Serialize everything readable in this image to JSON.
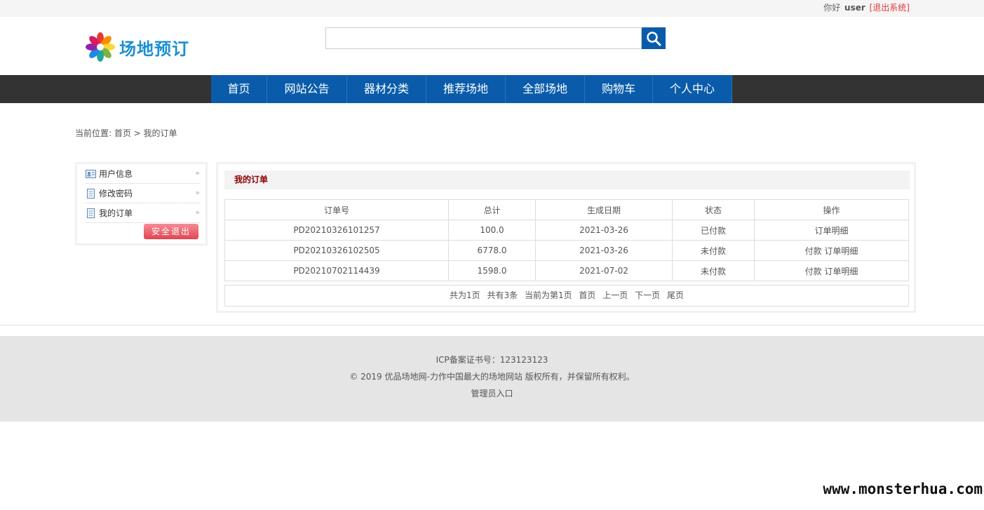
{
  "topbar": {
    "greeting": "你好",
    "username": "user",
    "logout_link": "[退出系统]"
  },
  "header": {
    "site_title": "场地预订",
    "search_placeholder": "",
    "search_icon": "search-icon"
  },
  "nav": {
    "items": [
      "首页",
      "网站公告",
      "器材分类",
      "推荐场地",
      "全部场地",
      "购物车",
      "个人中心"
    ]
  },
  "breadcrumb": {
    "text": "当前位置: 首页 > 我的订单"
  },
  "sidebar": {
    "items": [
      {
        "label": "用户信息",
        "icon": "user-card-icon"
      },
      {
        "label": "修改密码",
        "icon": "document-icon"
      },
      {
        "label": "我的订单",
        "icon": "document-icon"
      }
    ],
    "logout_button": "安全退出"
  },
  "orders": {
    "title": "我的订单",
    "columns": [
      "订单号",
      "总计",
      "生成日期",
      "状态",
      "操作"
    ],
    "rows": [
      {
        "id": "PD20210326101257",
        "total": "100.0",
        "date": "2021-03-26",
        "status": "已付款",
        "pay": "",
        "detail": "订单明细"
      },
      {
        "id": "PD20210326102505",
        "total": "6778.0",
        "date": "2021-03-26",
        "status": "未付款",
        "pay": "付款",
        "detail": "订单明细"
      },
      {
        "id": "PD20210702114439",
        "total": "1598.0",
        "date": "2021-07-02",
        "status": "未付款",
        "pay": "付款",
        "detail": "订单明细"
      }
    ],
    "pager": {
      "total_pages": "共为1页",
      "total_items": "共有3条",
      "current": "当前为第1页",
      "first": "首页",
      "prev": "上一页",
      "next": "下一页",
      "last": "尾页"
    }
  },
  "footer": {
    "icp": "ICP备案证书号：123123123",
    "copyright": "© 2019 优品场地网-力作中国最大的场地网站 版权所有，并保留所有权利。",
    "admin_link": "管理员入口"
  },
  "watermark": "www.monsterhua.com",
  "colors": {
    "nav_blue": "#0a5caa",
    "nav_dark": "#333333",
    "logout_red": "#e04552",
    "title_red": "#8b0000"
  }
}
